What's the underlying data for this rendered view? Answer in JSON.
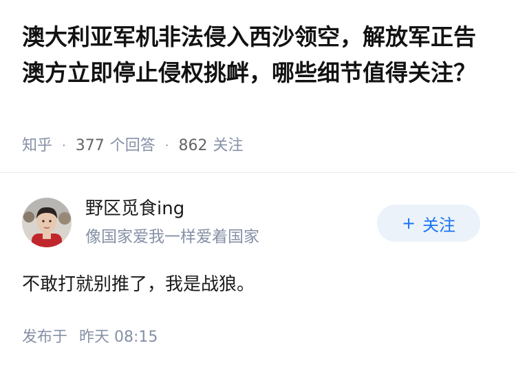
{
  "question": {
    "title": "澳大利亚军机非法侵入西沙领空，解放军正告澳方立即停止侵权挑衅，哪些细节值得关注？"
  },
  "meta": {
    "source": "知乎",
    "separator": "·",
    "answers_count": "377",
    "answers_label": "个回答",
    "followers_count": "862",
    "followers_label": "关注"
  },
  "author": {
    "name": "野区觅食ing",
    "bio": "像国家爱我一样爱着国家"
  },
  "follow_button": {
    "plus": "+",
    "label": "关注"
  },
  "answer": {
    "content": "不敢打就别推了，我是战狼。",
    "published_label": "发布于",
    "published_time": "昨天 08:15"
  },
  "colors": {
    "accent": "#1772f6",
    "follow_bg": "#ebf2fa",
    "muted_text": "#8590a6"
  }
}
